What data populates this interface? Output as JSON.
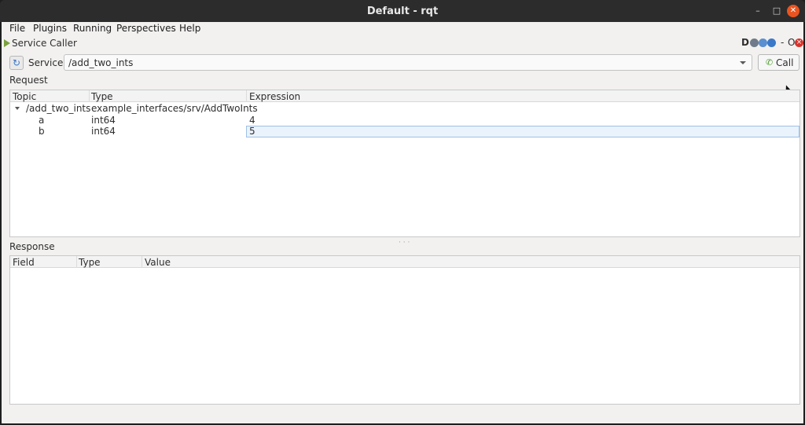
{
  "window": {
    "title": "Default - rqt",
    "minimize_glyph": "–",
    "maximize_glyph": "□",
    "close_glyph": "✕"
  },
  "menubar": {
    "items": [
      "File",
      "Plugins",
      "Running",
      "Perspectives",
      "Help"
    ]
  },
  "plugin": {
    "title": "Service Caller",
    "buttons": {
      "d_label": "D",
      "dash_label": "-",
      "o_label": "O",
      "close_glyph": "×"
    }
  },
  "service": {
    "label": "Service",
    "value": "/add_two_ints",
    "refresh_glyph": "↻",
    "call_label": "Call",
    "call_icon_glyph": "✆"
  },
  "request": {
    "label": "Request",
    "columns": [
      "Topic",
      "Type",
      "Expression"
    ],
    "rows": [
      {
        "topic": "/add_two_ints",
        "type": "example_interfaces/srv/AddTwoInts",
        "expression": ""
      },
      {
        "topic": "a",
        "type": "int64",
        "expression": "4"
      },
      {
        "topic": "b",
        "type": "int64",
        "expression": "5"
      }
    ]
  },
  "response": {
    "label": "Response",
    "columns": [
      "Field",
      "Type",
      "Value"
    ]
  },
  "colors": {
    "titlebar": "#2c2c2c",
    "window_bg": "#f2f1f0",
    "close_button": "#e95420",
    "selection": "#eaf2fb"
  }
}
